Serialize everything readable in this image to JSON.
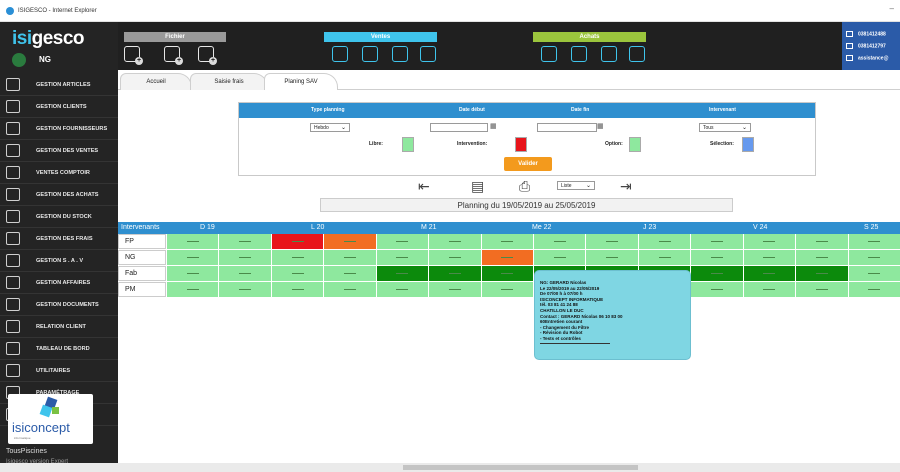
{
  "window": {
    "title": "ISIGESCO - Internet Explorer"
  },
  "app": {
    "logo_prefix": "isi",
    "logo_suffix": "gesco",
    "user_initial": "",
    "user_name": "NG"
  },
  "menu": [
    {
      "label": "GESTION ARTICLES",
      "icon": "box-icon"
    },
    {
      "label": "GESTION CLIENTS",
      "icon": "clients-icon"
    },
    {
      "label": "GESTION FOURNISSEURS",
      "icon": "suppliers-icon"
    },
    {
      "label": "GESTION DES VENTES",
      "icon": "sales-icon"
    },
    {
      "label": "VENTES COMPTOIR",
      "icon": "counter-icon"
    },
    {
      "label": "GESTION DES ACHATS",
      "icon": "purchase-icon"
    },
    {
      "label": "GESTION DU STOCK",
      "icon": "stock-icon"
    },
    {
      "label": "GESTION DES FRAIS",
      "icon": "fees-icon"
    },
    {
      "label": "GESTION S . A . V",
      "icon": "wrench-icon"
    },
    {
      "label": "GESTION AFFAIRES",
      "icon": "briefcase-icon"
    },
    {
      "label": "GESTION DOCUMENTS",
      "icon": "folder-icon"
    },
    {
      "label": "RELATION CLIENT",
      "icon": "contact-icon"
    },
    {
      "label": "TABLEAU DE BORD",
      "icon": "dashboard-icon"
    },
    {
      "label": "UTILITAIRES",
      "icon": "tools-icon"
    },
    {
      "label": "PARAMÉTRAGE",
      "icon": "gear-icon"
    },
    {
      "label": "INFORMATION",
      "icon": "info-icon"
    }
  ],
  "brand": {
    "word": "isiconcept",
    "sub": "informatique"
  },
  "client": {
    "name": "TousPiscines",
    "sub": "Isigesco version Expert"
  },
  "toolbar": {
    "groups": [
      {
        "label": "Fichier",
        "color": "#9a9a9a"
      },
      {
        "label": "Ventes",
        "color": "#3fc4ec"
      },
      {
        "label": "Achats",
        "color": "#9bc53d"
      }
    ]
  },
  "contact": {
    "phone": "0381412488",
    "fax": "0381412797",
    "email": "assistance@"
  },
  "tabs": [
    "Accueil",
    "Saisie frais",
    "Planing SAV"
  ],
  "filter": {
    "headers": [
      "Type planning",
      "Date début",
      "Date fin",
      "Intervenant"
    ],
    "type_value": "Hebdo",
    "intervenant_value": "Tous",
    "legend": [
      {
        "label": "Libre:",
        "color": "#8ee89e"
      },
      {
        "label": "Intervention:",
        "color": "#e8141b"
      },
      {
        "label": "Option:",
        "color": "#8ee89e"
      },
      {
        "label": "Sélection:",
        "color": "#6699ee"
      }
    ],
    "valider": "Valider"
  },
  "view_select": "Liste",
  "range": "Planning du 19/05/2019 au 25/05/2019",
  "grid": {
    "header_label": "Intervenants",
    "days": [
      "D 19",
      "L 20",
      "M 21",
      "Me 22",
      "J 23",
      "V 24",
      "S 25"
    ],
    "rows": [
      {
        "name": "FP",
        "cells": [
          "#8ee89e",
          "#8ee89e",
          "#e8141b",
          "#f26d22",
          "#8ee89e",
          "#8ee89e",
          "#8ee89e",
          "#8ee89e",
          "#8ee89e",
          "#8ee89e",
          "#8ee89e",
          "#8ee89e",
          "#8ee89e",
          "#8ee89e"
        ]
      },
      {
        "name": "NG",
        "cells": [
          "#8ee89e",
          "#8ee89e",
          "#8ee89e",
          "#8ee89e",
          "#8ee89e",
          "#8ee89e",
          "#f26d22",
          "#8ee89e",
          "#8ee89e",
          "#8ee89e",
          "#8ee89e",
          "#8ee89e",
          "#8ee89e",
          "#8ee89e"
        ]
      },
      {
        "name": "Fab",
        "cells": [
          "#8ee89e",
          "#8ee89e",
          "#8ee89e",
          "#8ee89e",
          "#0c8a0c",
          "#0c8a0c",
          "#0c8a0c",
          "#0c8a0c",
          "#0c8a0c",
          "#0c8a0c",
          "#0c8a0c",
          "#0c8a0c",
          "#0c8a0c",
          "#8ee89e"
        ]
      },
      {
        "name": "PM",
        "cells": [
          "#8ee89e",
          "#8ee89e",
          "#8ee89e",
          "#8ee89e",
          "#8ee89e",
          "#8ee89e",
          "#8ee89e",
          "#8ee89e",
          "#8ee89e",
          "#8ee89e",
          "#8ee89e",
          "#8ee89e",
          "#8ee89e",
          "#8ee89e"
        ]
      }
    ]
  },
  "popup": [
    "NG: GERARD Nicolas",
    "Le 22/05/2019 au 22/05/2019",
    "De 07/00 h à 07/00 h",
    "ISICONCEPT INFORMATIQUE",
    "tél. 03 81 41 24 88",
    "CHATILLON LE DUC",
    "Contact : GERARD Nicolas 06 10 83 00",
    "60Entretien courant",
    "- Changement du Filtre",
    "- Révision du Robot",
    "- Tests et contrôles"
  ]
}
